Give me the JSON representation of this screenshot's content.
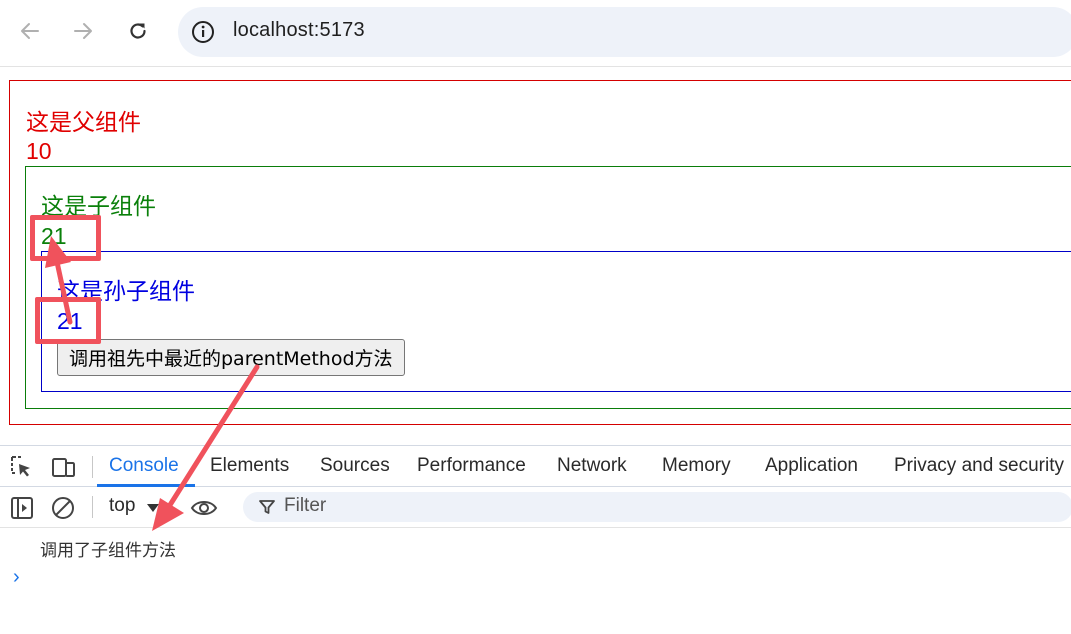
{
  "browser": {
    "url": "localhost:5173"
  },
  "page": {
    "parent": {
      "title": "这是父组件",
      "count": "10"
    },
    "child": {
      "title": "这是子组件",
      "count": "21"
    },
    "grandchild": {
      "title": "这是孙子组件",
      "count": "21",
      "button_label": "调用祖先中最近的parentMethod方法"
    }
  },
  "devtools": {
    "tabs": [
      {
        "label": "Console"
      },
      {
        "label": "Elements"
      },
      {
        "label": "Sources"
      },
      {
        "label": "Performance"
      },
      {
        "label": "Network"
      },
      {
        "label": "Memory"
      },
      {
        "label": "Application"
      },
      {
        "label": "Privacy and security"
      }
    ],
    "active_tab": "Console",
    "context": "top",
    "filter_placeholder": "Filter",
    "console_messages": [
      "调用了子组件方法"
    ],
    "prompt_symbol": "›"
  },
  "colors": {
    "parent": "#e00000",
    "child": "#0a800a",
    "grandchild": "#0000e0",
    "annotation": "#f0525c",
    "accent": "#1a73e8"
  }
}
